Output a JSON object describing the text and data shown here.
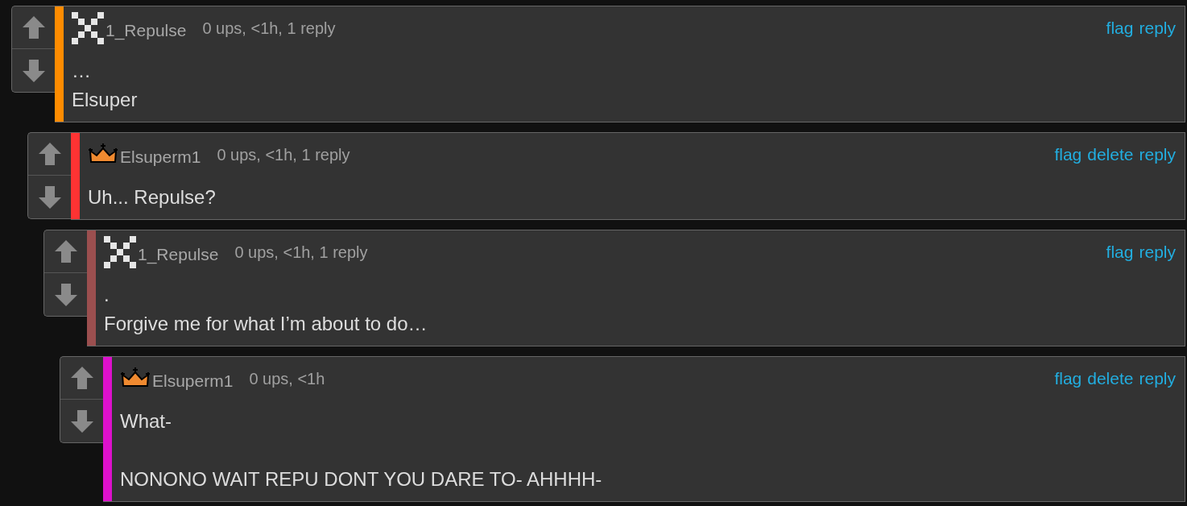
{
  "comments": [
    {
      "avatar": {
        "kind": "checker"
      },
      "username": "1_Repulse",
      "meta": "0 ups, <1h, 1 reply",
      "actions": [
        "flag",
        "reply"
      ],
      "color": "#ff8c00",
      "body": "…\nElsuper",
      "children": [
        {
          "avatar": {
            "kind": "crown"
          },
          "username": "Elsuperm1",
          "meta": "0 ups, <1h, 1 reply",
          "actions": [
            "flag",
            "delete",
            "reply"
          ],
          "color": "#ff3333",
          "body": "Uh... Repulse?",
          "children": [
            {
              "avatar": {
                "kind": "checker"
              },
              "username": "1_Repulse",
              "meta": "0 ups, <1h, 1 reply",
              "actions": [
                "flag",
                "reply"
              ],
              "color": "#9b4f4f",
              "body": ".\nForgive me for what I’m about to do…",
              "children": [
                {
                  "avatar": {
                    "kind": "crown"
                  },
                  "username": "Elsuperm1",
                  "meta": "0 ups, <1h",
                  "actions": [
                    "flag",
                    "delete",
                    "reply"
                  ],
                  "color": "#dd11cc",
                  "body": "What-\n\nNONONO WAIT REPU DONT YOU DARE TO- AHHHH-"
                }
              ]
            }
          ]
        }
      ]
    }
  ]
}
